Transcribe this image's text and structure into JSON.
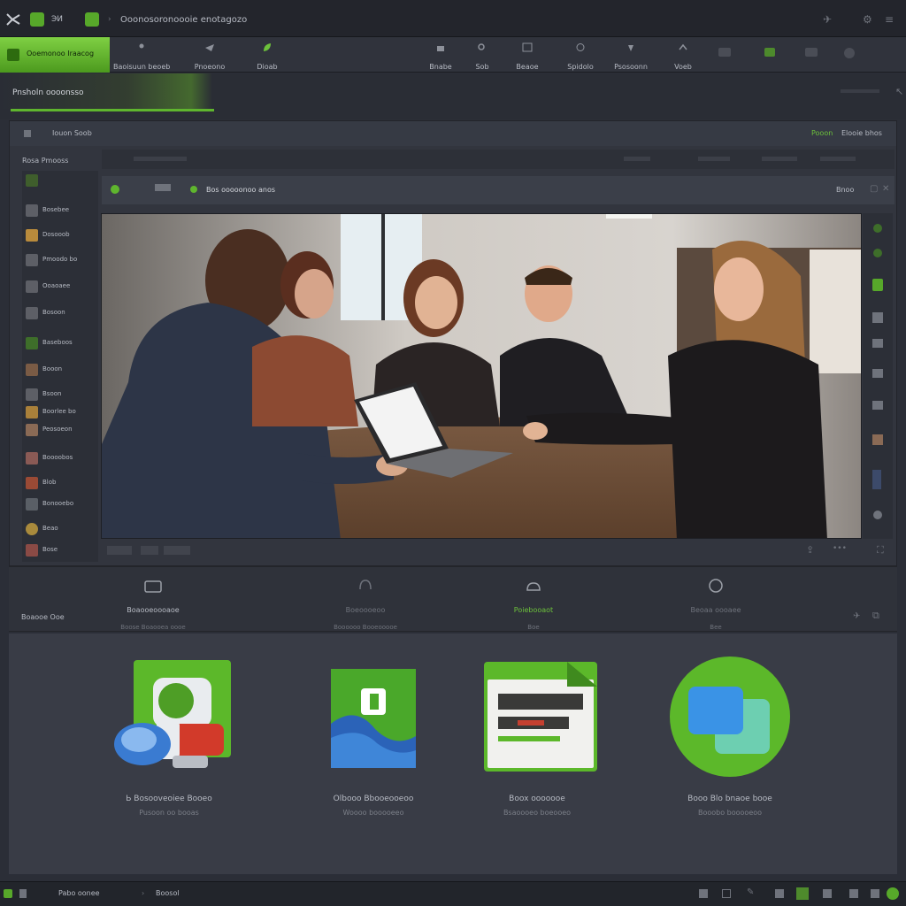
{
  "titlebar": {
    "title": "Ooonosoronoooie enotagozo",
    "tabs": [
      "ЭИ"
    ]
  },
  "toolbar": {
    "brand": "Ooemonoo Iraacog",
    "items": [
      {
        "label": "Baoisuun beoeb",
        "icon": "user-icon"
      },
      {
        "label": "Pnoeono",
        "icon": "share-icon"
      },
      {
        "label": "Dioab",
        "icon": "leaf-icon"
      },
      {
        "label": "Bnabe",
        "icon": "lock-icon"
      },
      {
        "label": "Sob",
        "icon": "search-icon"
      },
      {
        "label": "Beaoe",
        "icon": "window-icon"
      },
      {
        "label": "Spidolo",
        "icon": "clock-icon"
      },
      {
        "label": "Psosoonn",
        "icon": "pin-icon"
      },
      {
        "label": "Voeb",
        "icon": "arrow-icon"
      }
    ]
  },
  "section": {
    "title": "Pnsholn oooonsso"
  },
  "panel": {
    "header_label": "Iouon Soob",
    "header_right_green": "Pooon",
    "header_right": "Elooie bhos",
    "sidebar_title": "Rosa Pmooss",
    "sidebar": [
      "Bosebee",
      "Dosooob",
      "Pmoodo bo",
      "Ooaoaee",
      "Bosoon",
      "Baseboos",
      "Booon",
      "Bsoon",
      "Boorlee bo",
      "Peosoeon",
      "Boooobos",
      "Blob",
      "Bonooebo",
      "Beao",
      "Bose"
    ],
    "video_title": "Bos ooooonoo anos",
    "video_right": "Bnoo"
  },
  "actions": [
    {
      "label": "Boaooeoooaoe",
      "sub": "Boose  Boaooea oooe",
      "icon": "folder-icon",
      "active": false
    },
    {
      "label": "Boeoooeoo",
      "sub": "Boooooo  Booeooooe",
      "icon": "headset-icon",
      "active": false
    },
    {
      "label": "Poiebooaot",
      "sub": "Boe",
      "icon": "cloud-icon",
      "active": true
    },
    {
      "label": "Beoaa oooaee",
      "sub": "Bee",
      "icon": "circle-icon",
      "active": false
    }
  ],
  "actions_left_label": "Boaooe Ooe",
  "tiles": [
    {
      "title": "Ь Bosooveoiee Booeo",
      "sub": "Pusoon oo booas",
      "icon": "robot-app-icon"
    },
    {
      "title": "Olbooo Bbooeooeoo",
      "sub": "Woooo booooeeo",
      "icon": "wave-app-icon"
    },
    {
      "title": "Boox ooooooe",
      "sub": "Bsaoooeo boeooeo",
      "icon": "document-app-icon"
    },
    {
      "title": "Booo Blo bnaoe booe",
      "sub": "Booobo booooeoo",
      "icon": "chat-app-icon"
    }
  ],
  "statusbar": {
    "left": "Pabo oonee",
    "mid": "Boosol"
  },
  "colors": {
    "accent": "#6cc13b",
    "bg": "#2b2e37",
    "panel": "#32353e"
  }
}
